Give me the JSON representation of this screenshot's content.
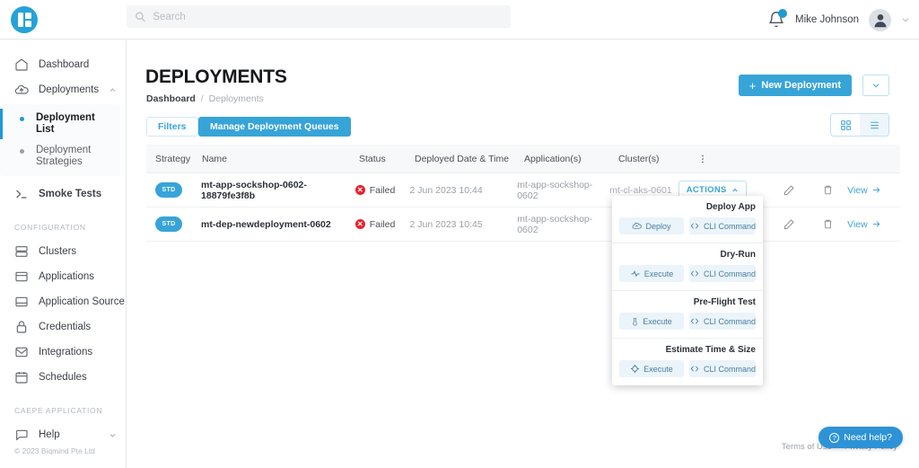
{
  "topbar": {
    "logo_name": "biqmind-logo",
    "search": {
      "placeholder": "Search",
      "value": ""
    },
    "notifications_count": "",
    "user_name": "Mike Johnson"
  },
  "sidebar": {
    "items": [
      {
        "label": "Dashboard",
        "icon": "home-icon",
        "chevron": false
      },
      {
        "label": "Deployments",
        "icon": "cloud-upload-icon",
        "chevron": "up"
      }
    ],
    "sub_items": [
      {
        "label": "Deployment List",
        "active": true
      },
      {
        "label": "Deployment Strategies",
        "active": false
      }
    ],
    "smoke_tests": {
      "label": "Smoke Tests",
      "icon": "terminal-icon"
    },
    "section_configuration": "CONFIGURATION",
    "config_items": [
      {
        "label": "Clusters",
        "icon": "servers-icon",
        "chevron": false
      },
      {
        "label": "Applications",
        "icon": "window-icon",
        "chevron": false
      },
      {
        "label": "Application Source",
        "icon": "source-icon",
        "chevron": "down"
      },
      {
        "label": "Credentials",
        "icon": "lock-icon",
        "chevron": false
      },
      {
        "label": "Integrations",
        "icon": "mail-icon",
        "chevron": false
      },
      {
        "label": "Schedules",
        "icon": "calendar-icon",
        "chevron": false
      }
    ],
    "section_application": "CAEPE APPLICATION",
    "app_items": [
      {
        "label": "Help",
        "icon": "chat-icon",
        "chevron": "down"
      }
    ],
    "copyright": "© 2023 Biqmind Pte Ltd"
  },
  "main": {
    "title": "DEPLOYMENTS",
    "breadcrumb": {
      "first": "Dashboard",
      "separator": "/",
      "second": "Deployments"
    },
    "new_deployment_label": "New Deployment",
    "new_deployment_plus": "+",
    "filters_label": "Filters",
    "queues_label": "Manage Deployment Queues",
    "view_grid_icon": "grid-view-icon",
    "view_list_icon": "list-view-icon"
  },
  "table": {
    "columns": [
      "Strategy",
      "Name",
      "Status",
      "Deployed Date & Time",
      "Application(s)",
      "Cluster(s)"
    ],
    "rows": [
      {
        "strategy": "STD",
        "name": "mt-app-sockshop-0602-18879fe3f8b",
        "status": "Failed",
        "date": "2 Jun 2023 10:44",
        "application": "mt-app-sockshop-0602",
        "cluster": "mt-cl-aks-0601",
        "actions_label": "ACTIONS",
        "view_label": "View"
      },
      {
        "strategy": "STD",
        "name": "mt-dep-newdeployment-0602",
        "status": "Failed",
        "date": "2 Jun 2023 10:45",
        "application": "mt-app-sockshop-0602",
        "cluster": "",
        "actions_label": "",
        "view_label": "View"
      }
    ]
  },
  "dropdown": {
    "groups": [
      {
        "title": "Deploy App",
        "primary_label": "Deploy",
        "primary_icon": "cloud-upload-icon",
        "cli_label": "CLI Command"
      },
      {
        "title": "Dry-Run",
        "primary_label": "Execute",
        "primary_icon": "pulse-icon",
        "cli_label": "CLI Command"
      },
      {
        "title": "Pre-Flight Test",
        "primary_label": "Execute",
        "primary_icon": "thermometer-icon",
        "cli_label": "CLI Command"
      },
      {
        "title": "Estimate Time & Size",
        "primary_label": "Execute",
        "primary_icon": "target-icon",
        "cli_label": "CLI Command"
      }
    ]
  },
  "footer": {
    "terms_label": "Terms of Use",
    "privacy_label": "Privacy Policy",
    "need_help_label": "Need help?"
  },
  "colors": {
    "brand_blue": "#37a4d8",
    "logo_blue": "#25a3d8",
    "danger_red": "#e8212e",
    "link_blue": "#3aa5da",
    "help_blue": "#2d93d6"
  }
}
